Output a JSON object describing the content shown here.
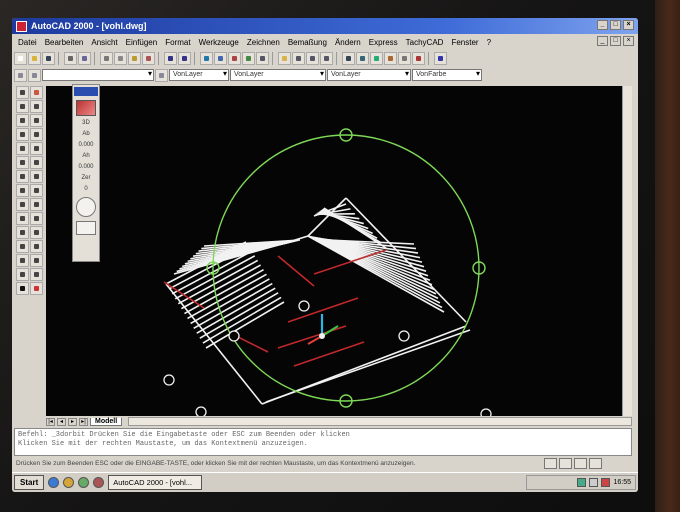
{
  "window": {
    "title": "AutoCAD 2000 - [vohl.dwg]"
  },
  "menu": [
    "Datei",
    "Bearbeiten",
    "Ansicht",
    "Einfügen",
    "Format",
    "Werkzeuge",
    "Zeichnen",
    "Bemaßung",
    "Ändern",
    "Express",
    "TachyCAD",
    "Fenster",
    "?"
  ],
  "toolbar": {
    "layer_combo": "VonLayer",
    "linetype_combo": "VonLayer",
    "lineweight_combo": "VonLayer",
    "color_combo": "VonFarbe"
  },
  "palette": {
    "mode": "3D",
    "values": [
      {
        "label": "Ab",
        "value": "0.000"
      },
      {
        "label": "Ah",
        "value": "0.000"
      },
      {
        "label": "Zer",
        "value": "0"
      }
    ]
  },
  "layout_tabs": [
    "Modell"
  ],
  "command_line": {
    "lines": [
      "Befehl: _3dorbit Drücken Sie die Eingabetaste oder ESC zum Beenden oder klicken",
      "Klicken Sie mit der rechten Maustaste, um das Kontextmenü anzuzeigen."
    ]
  },
  "status_text": "Drücken Sie zum Beenden ESC oder die EINGABE-TASTE, oder klicken Sie mit der rechten Maustaste, um das Kontextmenü anzuzeigen.",
  "taskbar": {
    "start_label": "Start",
    "task_button": "AutoCAD 2000 - [vohl...",
    "clock": "16:55"
  },
  "colors": {
    "canvas": "#050505",
    "wireframe": "#f2f2f2",
    "hatch_red": "#c0282a",
    "orbit_circle": "#7ed957",
    "titlebar": "#1d3a9e"
  }
}
